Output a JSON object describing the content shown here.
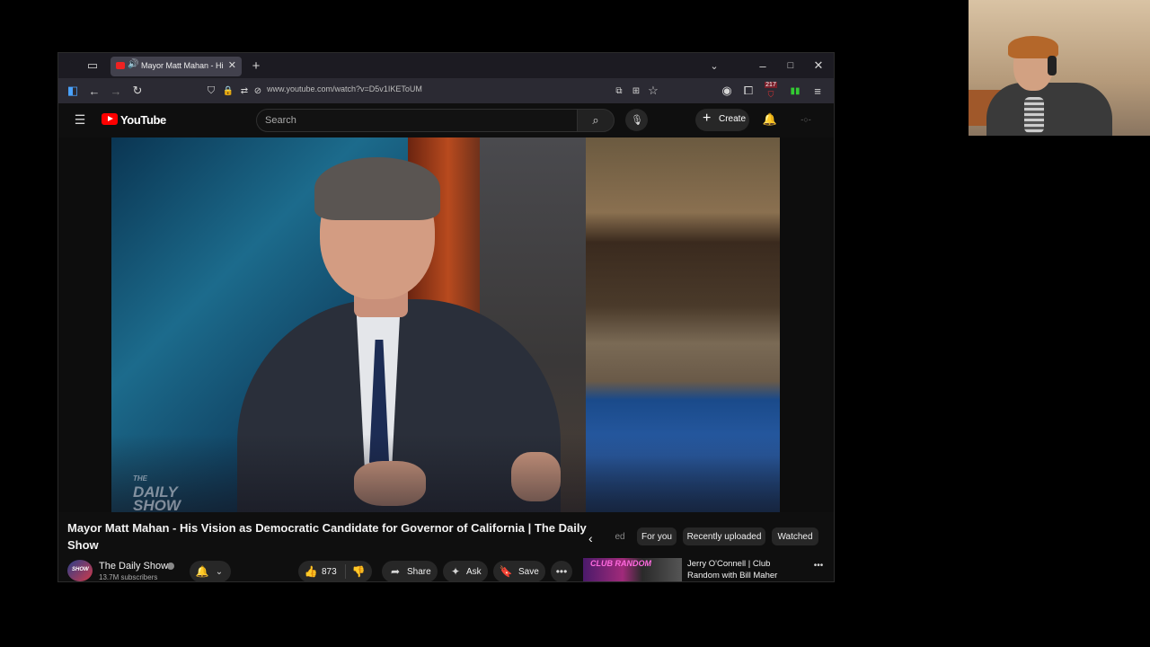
{
  "browser": {
    "tab_title": "Mayor Matt Mahan - His V",
    "url": "www.youtube.com/watch?v=D5v1IKEToUM",
    "badge_count": "217"
  },
  "youtube": {
    "logo": "YouTube",
    "search_placeholder": "Search",
    "create_label": "Create"
  },
  "video": {
    "watermark": "THE DAILY SHOW",
    "title": "Mayor Matt Mahan - His Vision as Democratic Candidate for Governor of California | The Daily Show",
    "channel": "The Daily Show",
    "subscribers": "13.7M subscribers",
    "likes": "873",
    "share_label": "Share",
    "ask_label": "Ask",
    "save_label": "Save"
  },
  "chips": {
    "partial": "ed",
    "items": [
      "For you",
      "Recently uploaded",
      "Watched"
    ]
  },
  "recommendation": {
    "thumb_text": "CLUB RANDOM",
    "title": "Jerry O'Connell | Club Random with Bill Maher"
  },
  "colors": {
    "youtube_red": "#ff0000",
    "background": "#0f0f0f",
    "chip_bg": "#272727"
  }
}
